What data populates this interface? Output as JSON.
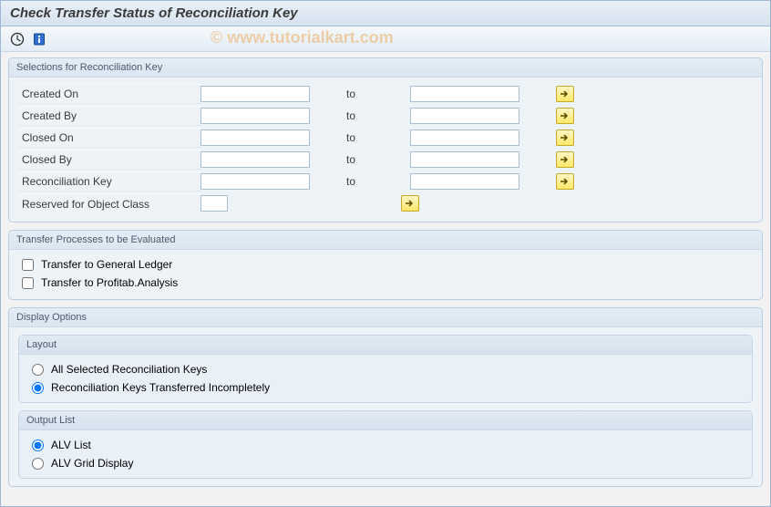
{
  "watermark": "© www.tutorialkart.com",
  "title": "Check Transfer Status of Reconciliation Key",
  "groups": {
    "selections": {
      "title": "Selections for Reconciliation Key",
      "rangeRows": [
        {
          "label": "Created On",
          "to": "to"
        },
        {
          "label": "Created By",
          "to": "to"
        },
        {
          "label": "Closed On",
          "to": "to"
        },
        {
          "label": "Closed By",
          "to": "to"
        },
        {
          "label": "Reconciliation Key",
          "to": "to"
        }
      ],
      "reservedLabel": "Reserved for Object Class"
    },
    "transfer": {
      "title": "Transfer Processes to be Evaluated",
      "items": [
        "Transfer to General Ledger",
        "Transfer to Profitab.Analysis"
      ]
    },
    "display": {
      "title": "Display Options",
      "layout": {
        "title": "Layout",
        "options": [
          "All Selected Reconciliation Keys",
          "Reconciliation Keys Transferred Incompletely"
        ],
        "selectedIndex": 1
      },
      "output": {
        "title": "Output List",
        "options": [
          "ALV List",
          "ALV Grid Display"
        ],
        "selectedIndex": 0
      }
    }
  }
}
